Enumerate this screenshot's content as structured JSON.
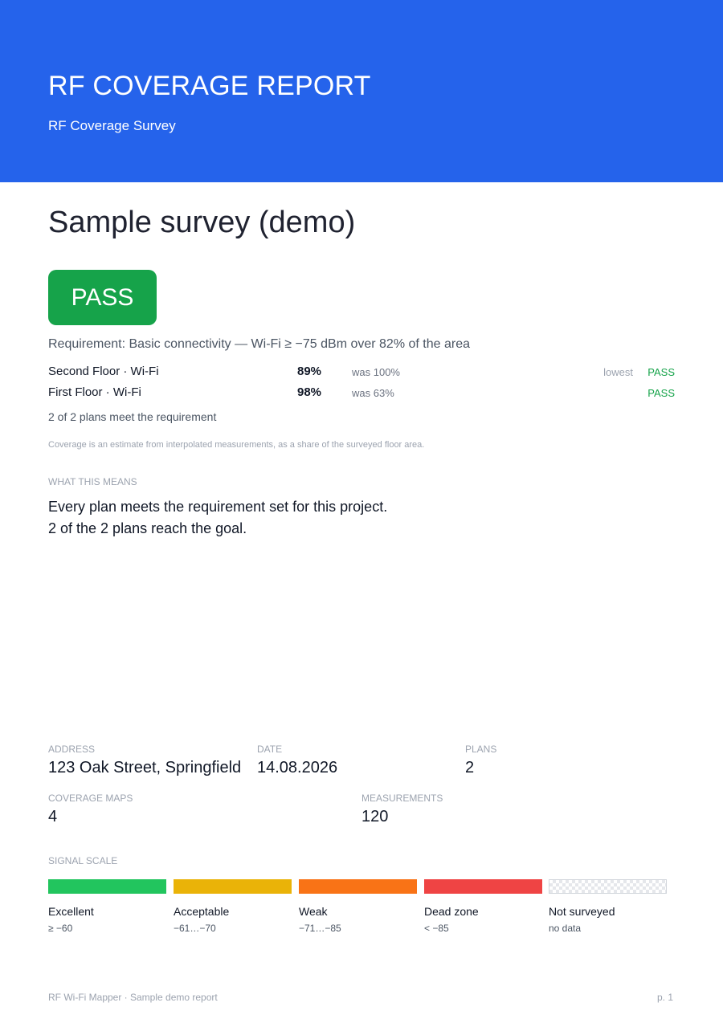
{
  "header": {
    "title": "RF COVERAGE REPORT",
    "subtitle": "RF Coverage Survey",
    "background_color": "#2563eb"
  },
  "survey": {
    "title": "Sample survey (demo)"
  },
  "verdict": {
    "label": "PASS",
    "color": "#16a34a"
  },
  "requirement": {
    "text": "Requirement: Basic connectivity — Wi-Fi ≥ −75 dBm over 82% of the area"
  },
  "plans": [
    {
      "name": "Second Floor · Wi-Fi",
      "coverage": "89%",
      "previous": "was 100%",
      "note": "lowest",
      "status": "PASS"
    },
    {
      "name": "First Floor · Wi-Fi",
      "coverage": "98%",
      "previous": "was 63%",
      "note": "",
      "status": "PASS"
    }
  ],
  "plans_summary": "2 of 2 plans meet the requirement",
  "coverage_note": "Coverage is an estimate from interpolated measurements, as a share of the surveyed floor area.",
  "meaning": {
    "heading": "WHAT THIS MEANS",
    "lines": [
      "Every plan meets the requirement set for this project.",
      "2 of the 2 plans reach the goal."
    ]
  },
  "stats": {
    "address": {
      "label": "ADDRESS",
      "value": "123 Oak Street, Springfield"
    },
    "date": {
      "label": "DATE",
      "value": "14.08.2026"
    },
    "plans": {
      "label": "PLANS",
      "value": "2"
    },
    "coverage_maps": {
      "label": "COVERAGE MAPS",
      "value": "4"
    },
    "measurements": {
      "label": "MEASUREMENTS",
      "value": "120"
    }
  },
  "signal_scale": {
    "heading": "SIGNAL SCALE",
    "items": [
      {
        "name": "Excellent",
        "range": "≥ −60",
        "color": "#22c55e"
      },
      {
        "name": "Acceptable",
        "range": "−61…−70",
        "color": "#eab308"
      },
      {
        "name": "Weak",
        "range": "−71…−85",
        "color": "#f97316"
      },
      {
        "name": "Dead zone",
        "range": "< −85",
        "color": "#ef4444"
      },
      {
        "name": "Not surveyed",
        "range": "no data",
        "color": "checkered"
      }
    ]
  },
  "footer": {
    "left": "RF Wi-Fi Mapper · Sample demo report",
    "right": "p. 1"
  }
}
